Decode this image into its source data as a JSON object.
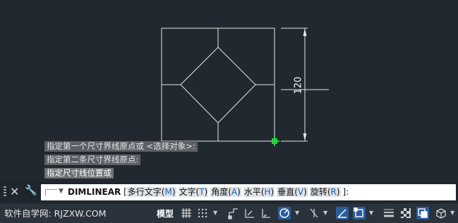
{
  "drawing": {
    "dimension_text": "120"
  },
  "command_history": [
    "指定第一个尺寸界线原点或 <选择对象>:",
    "指定第二条尺寸界线原点:",
    "指定尺寸线位置或"
  ],
  "command_line": {
    "command": "DIMLINEAR",
    "open_bracket": "[",
    "options": [
      {
        "label": "多行文字(",
        "key": "M",
        "close": ")"
      },
      {
        "label": "文字(",
        "key": "T",
        "close": ")"
      },
      {
        "label": "角度(",
        "key": "A",
        "close": ")"
      },
      {
        "label": "水平(",
        "key": "H",
        "close": ")"
      },
      {
        "label": "垂直(",
        "key": "V",
        "close": ")"
      },
      {
        "label": "旋转(",
        "key": "R",
        "close": ")"
      }
    ],
    "close_bracket": "]:",
    "close_button": "✕",
    "settings_button": "🔧"
  },
  "status_bar": {
    "watermark": "软件自学网: RJZXW.COM",
    "model_tab": "模型",
    "icons": [
      "grid-icon",
      "snap-grid-icon",
      "snap-dropdown-icon",
      "infer-constraints-icon",
      "dynamic-input-icon",
      "ortho-icon",
      "polar-tracking-icon",
      "polar-dropdown-icon",
      "isodraft-icon",
      "isodraft-dropdown-icon",
      "object-snap-tracking-icon",
      "object-snap-icon",
      "object-snap-dropdown-icon",
      "lineweight-icon",
      "transparency-icon",
      "selection-cycling-icon",
      "3d-osnap-icon",
      "3d-osnap-dropdown-icon"
    ]
  },
  "colors": {
    "background": "#212830",
    "geometry": "#ffffff",
    "snap_marker": "#2ecc40",
    "active_toggle": "#2b5d9a"
  }
}
